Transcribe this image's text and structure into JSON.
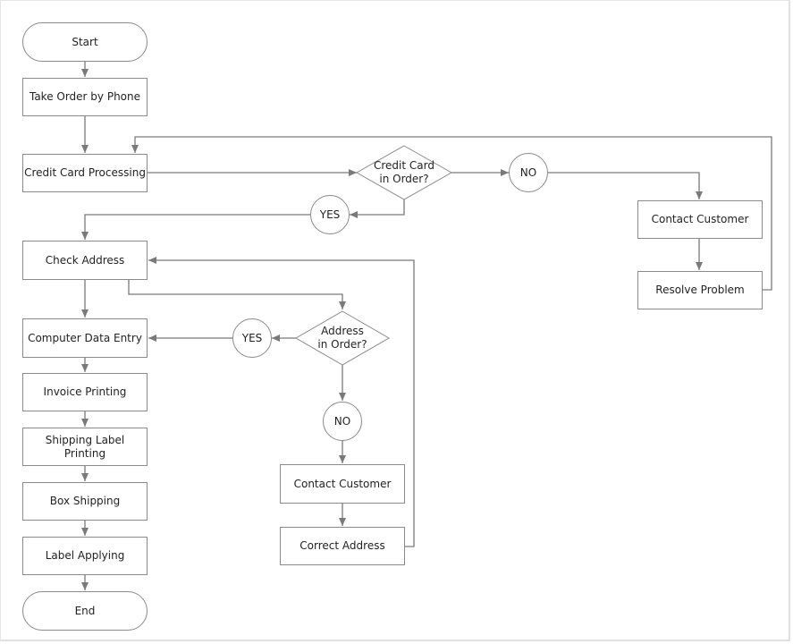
{
  "diagram": {
    "type": "flowchart",
    "nodes": {
      "start": "Start",
      "take_order": "Take Order by Phone",
      "cc_processing": "Credit Card Processing",
      "cc_decision": "Credit Card in Order?",
      "cc_no": "NO",
      "cc_yes": "YES",
      "contact_customer_1": "Contact Customer",
      "resolve_problem": "Resolve Problem",
      "check_address": "Check Address",
      "addr_decision": "Address in Order?",
      "addr_yes": "YES",
      "addr_no": "NO",
      "contact_customer_2": "Contact Customer",
      "correct_address": "Correct Address",
      "data_entry": "Computer Data Entry",
      "invoice": "Invoice Printing",
      "shipping_label": "Shipping Label Printing",
      "box_shipping": "Box Shipping",
      "label_applying": "Label Applying",
      "end": "End"
    },
    "decision_lines": {
      "cc_decision": [
        "Credit Card",
        "in Order?"
      ],
      "addr_decision": [
        "Address",
        "in Order?"
      ]
    },
    "edges": [
      {
        "from": "start",
        "to": "take_order"
      },
      {
        "from": "take_order",
        "to": "cc_processing"
      },
      {
        "from": "cc_processing",
        "to": "cc_decision"
      },
      {
        "from": "cc_decision",
        "to": "cc_no"
      },
      {
        "from": "cc_no",
        "to": "contact_customer_1"
      },
      {
        "from": "contact_customer_1",
        "to": "resolve_problem"
      },
      {
        "from": "resolve_problem",
        "to": "cc_processing"
      },
      {
        "from": "cc_decision",
        "to": "cc_yes"
      },
      {
        "from": "cc_yes",
        "to": "check_address"
      },
      {
        "from": "check_address",
        "to": "addr_decision"
      },
      {
        "from": "check_address",
        "to": "data_entry"
      },
      {
        "from": "addr_decision",
        "to": "addr_yes"
      },
      {
        "from": "addr_yes",
        "to": "data_entry"
      },
      {
        "from": "addr_decision",
        "to": "addr_no"
      },
      {
        "from": "addr_no",
        "to": "contact_customer_2"
      },
      {
        "from": "contact_customer_2",
        "to": "correct_address"
      },
      {
        "from": "correct_address",
        "to": "check_address"
      },
      {
        "from": "data_entry",
        "to": "invoice"
      },
      {
        "from": "invoice",
        "to": "shipping_label"
      },
      {
        "from": "shipping_label",
        "to": "box_shipping"
      },
      {
        "from": "box_shipping",
        "to": "label_applying"
      },
      {
        "from": "label_applying",
        "to": "end"
      }
    ],
    "colors": {
      "line": "#7a7a7a",
      "border": "#8a8a8a",
      "text": "#222222"
    }
  }
}
